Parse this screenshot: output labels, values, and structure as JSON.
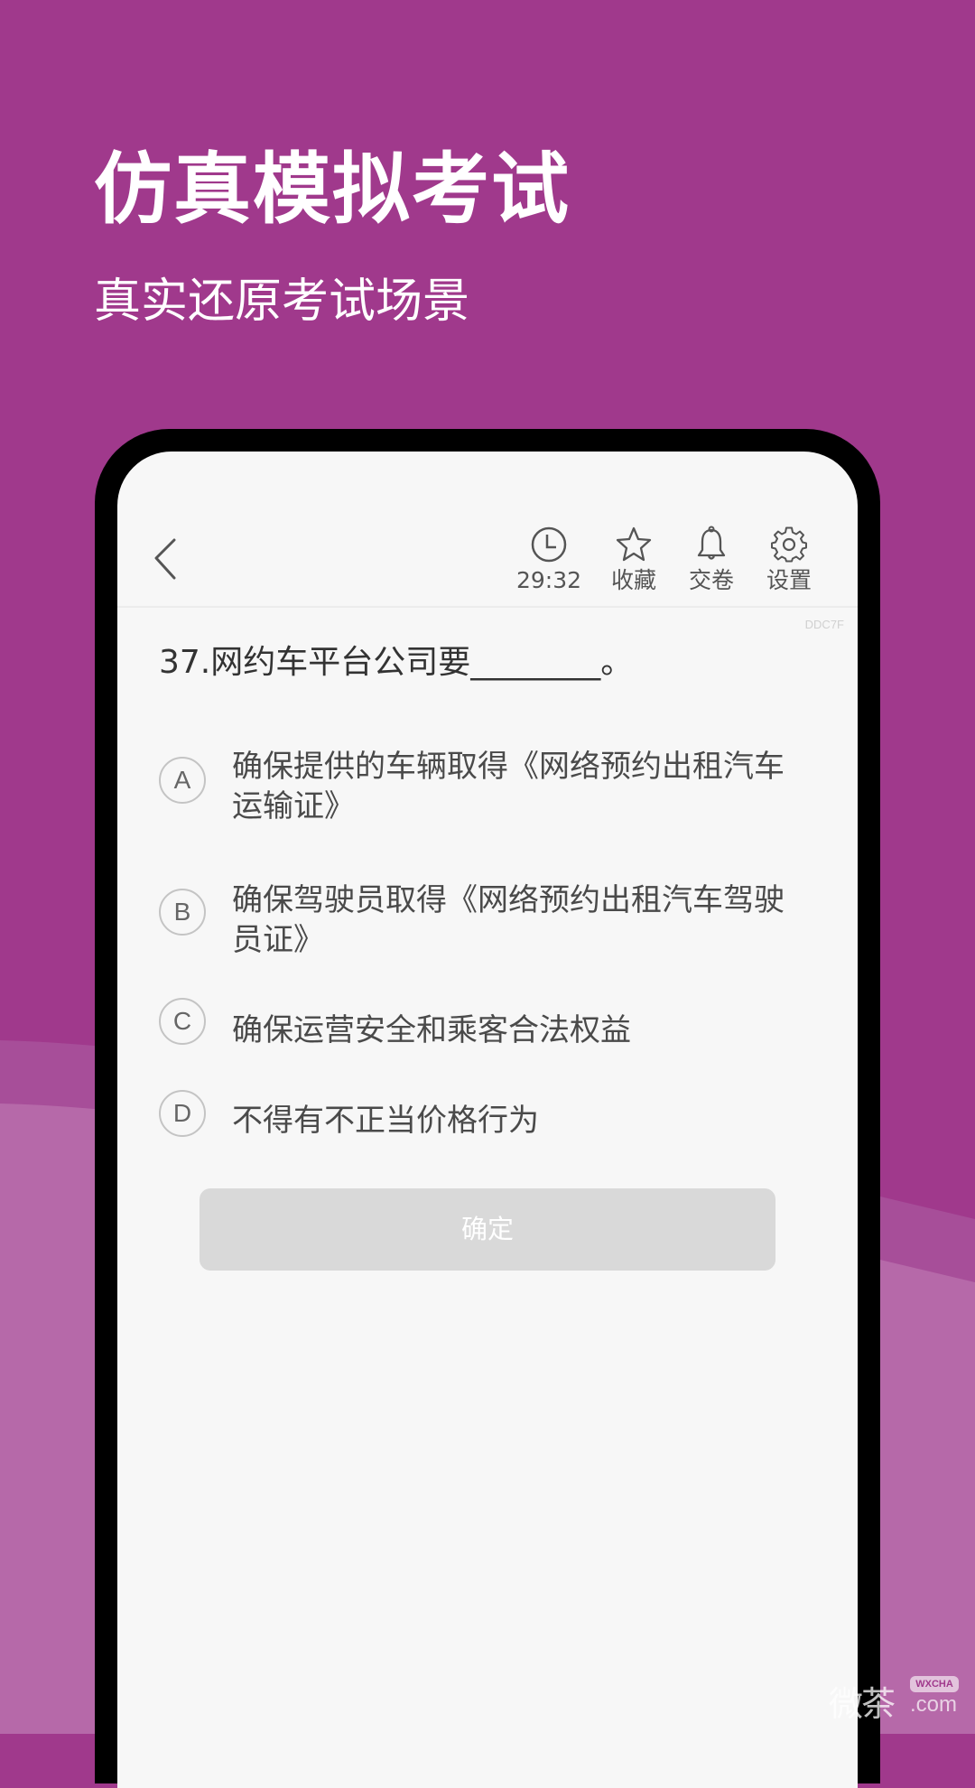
{
  "colors": {
    "background": "#A0398C",
    "screen_background": "#F7F7F7",
    "button_disabled": "#D9D9D9"
  },
  "hero": {
    "title": "仿真模拟考试",
    "subtitle": "真实还原考试场景"
  },
  "app": {
    "toolbar": {
      "back_icon": "chevron-left-icon",
      "items": [
        {
          "icon": "clock-icon",
          "label": "29:32"
        },
        {
          "icon": "star-icon",
          "label": "收藏"
        },
        {
          "icon": "bell-icon",
          "label": "交卷"
        },
        {
          "icon": "gear-icon",
          "label": "设置"
        }
      ]
    },
    "code_tag": "DDC7F",
    "question": "37.网约车平台公司要________。",
    "options": [
      {
        "letter": "A",
        "text": "确保提供的车辆取得《网络预约出租汽车运输证》"
      },
      {
        "letter": "B",
        "text": "确保驾驶员取得《网络预约出租汽车驾驶员证》"
      },
      {
        "letter": "C",
        "text": "确保运营安全和乘客合法权益"
      },
      {
        "letter": "D",
        "text": "不得有不正当价格行为"
      }
    ],
    "confirm_label": "确定"
  },
  "watermark": {
    "cn": "微茶",
    "badge": "WXCHA",
    "domain": ".com"
  }
}
